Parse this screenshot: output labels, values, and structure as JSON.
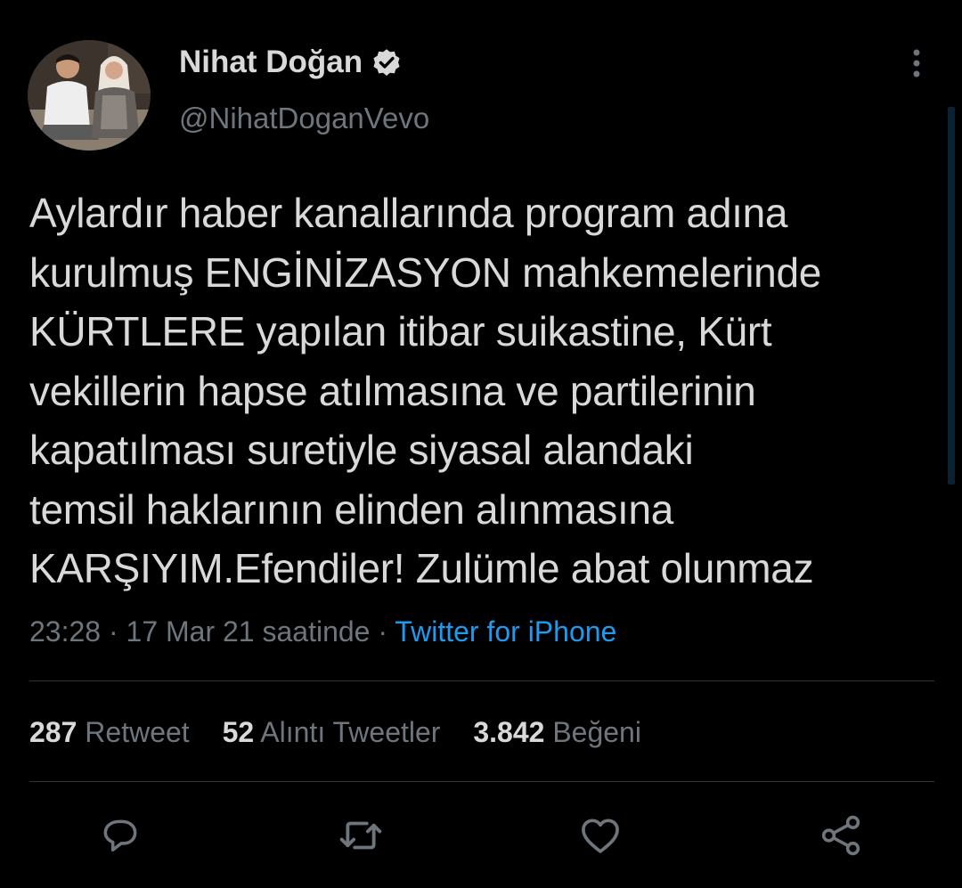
{
  "author": {
    "name": "Nihat Doğan",
    "handle": "@NihatDoganVevo"
  },
  "tweet": {
    "text": "Aylardır haber kanallarında program adına\nkurulmuş ENGİNİZASYON mahkemelerinde\nKÜRTLERE yapılan itibar suikastine, Kürt\nvekillerin hapse atılmasına ve partilerinin\nkapatılması suretiyle siyasal alandaki\ntemsil haklarının elinden alınmasına\nKARŞIYIM.Efendiler! Zulümle abat olunmaz",
    "time": "23:28",
    "date": "17 Mar 21 saatinde",
    "separator": "·",
    "source": "Twitter for iPhone"
  },
  "stats": {
    "retweets_count": "287",
    "retweets_label": "Retweet",
    "quotes_count": "52",
    "quotes_label": "Alıntı Tweetler",
    "likes_count": "3.842",
    "likes_label": "Beğeni"
  },
  "icons": {
    "verified": "verified-badge-icon",
    "more": "more-vertical-icon",
    "reply": "reply-icon",
    "retweet": "retweet-icon",
    "like": "heart-icon",
    "share": "share-icon"
  },
  "colors": {
    "background": "#000000",
    "text": "#d9d9d9",
    "secondary": "#6e767d",
    "link": "#1d9bf0"
  }
}
